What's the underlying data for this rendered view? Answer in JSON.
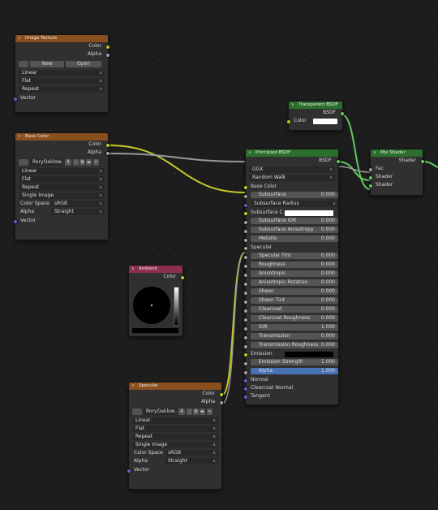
{
  "image_texture_node": {
    "title": "Image Texture",
    "outputs": [
      "Color",
      "Alpha"
    ],
    "new_label": "New",
    "open_label": "Open",
    "interpolation": "Linear",
    "projection": "Flat",
    "extension": "Repeat",
    "input_vector": "Vector"
  },
  "base_color_node": {
    "title": "Base Color",
    "outputs": [
      "Color",
      "Alpha"
    ],
    "image_name": "RoryOaklow...",
    "users": "4",
    "interpolation": "Linear",
    "projection": "Flat",
    "extension": "Repeat",
    "source": "Single Image",
    "color_space_label": "Color Space",
    "color_space": "sRGB",
    "alpha_label": "Alpha",
    "alpha_mode": "Straight",
    "input_vector": "Vector"
  },
  "specular_node": {
    "title": "Specular",
    "outputs": [
      "Color",
      "Alpha"
    ],
    "image_name": "RoryOaklow...",
    "users": "4",
    "interpolation": "Linear",
    "projection": "Flat",
    "extension": "Repeat",
    "source": "Single Image",
    "color_space_label": "Color Space",
    "color_space": "sRGB",
    "alpha_label": "Alpha",
    "alpha_mode": "Straight",
    "input_vector": "Vector"
  },
  "ambient_node": {
    "title": "Ambient",
    "output": "Color"
  },
  "transparent_node": {
    "title": "Transparent BSDF",
    "output": "BSDF",
    "input_color": "Color"
  },
  "mix_node": {
    "title": "Mix Shader",
    "output": "Shader",
    "inputs": [
      "Fac",
      "Shader",
      "Shader"
    ]
  },
  "principled_node": {
    "title": "Principled BSDF",
    "output": "BSDF",
    "distribution": "GGX",
    "subsurface_method": "Random Walk",
    "base_color": "Base Color",
    "subsurface": {
      "label": "Subsurface",
      "value": "0.000"
    },
    "subsurface_radius": "Subsurface Radius",
    "subsurface_color": "Subsurface C...",
    "subsurface_ior": {
      "label": "Subsurface IOR",
      "value": "0.000"
    },
    "subsurface_anisotropy": {
      "label": "Subsurface Anisotropy",
      "value": "0.000"
    },
    "metallic": {
      "label": "Metallic",
      "value": "0.000"
    },
    "specular": "Specular",
    "specular_tint": {
      "label": "Specular Tint",
      "value": "0.000"
    },
    "roughness": {
      "label": "Roughness",
      "value": "0.000"
    },
    "anisotropic": {
      "label": "Anisotropic",
      "value": "0.000"
    },
    "anisotropic_rotation": {
      "label": "Anisotropic Rotation",
      "value": "0.000"
    },
    "sheen": {
      "label": "Sheen",
      "value": "0.000"
    },
    "sheen_tint": {
      "label": "Sheen Tint",
      "value": "0.000"
    },
    "clearcoat": {
      "label": "Clearcoat",
      "value": "0.000"
    },
    "clearcoat_roughness": {
      "label": "Clearcoat Roughness",
      "value": "0.000"
    },
    "ior": {
      "label": "IOR",
      "value": "1.000"
    },
    "transmission": {
      "label": "Transmission",
      "value": "0.000"
    },
    "transmission_roughness": {
      "label": "Transmission Roughness",
      "value": "0.000"
    },
    "emission": "Emission",
    "emission_strength": {
      "label": "Emission Strength",
      "value": "1.000"
    },
    "alpha": {
      "label": "Alpha",
      "value": "1.000"
    },
    "normal": "Normal",
    "clearcoat_normal": "Clearcoat Normal",
    "tangent": "Tangent"
  },
  "colors": {
    "texture_header": "#8a4f1e",
    "shader_header": "#2c6e2c",
    "input_header": "#8c2f4c",
    "color_socket": "#c7c729",
    "float_socket": "#a1a1a1",
    "shader_socket": "#63c763",
    "vector_socket": "#6363c7",
    "active_field": "#4772b3"
  }
}
